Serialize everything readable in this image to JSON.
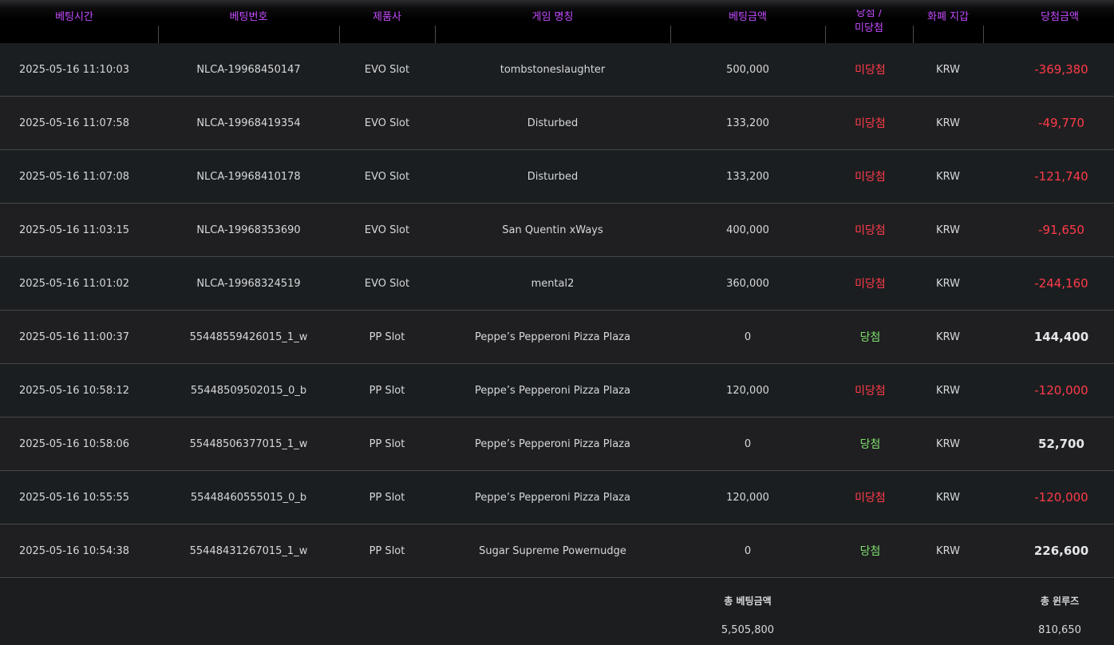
{
  "table": {
    "headers": {
      "time": "베팅시간",
      "bet_id": "베팅번호",
      "provider": "제품사",
      "game": "게임 명칭",
      "bet_amount": "베팅금액",
      "result_line1": "당첨 /",
      "result_line2": "미당첨",
      "currency": "화폐 지갑",
      "win_amount": "당첨금액"
    },
    "rows": [
      {
        "time": "2025-05-16 11:10:03",
        "bet_id": "NLCA-19968450147",
        "provider": "EVO Slot",
        "game": "tombstoneslaughter",
        "bet_amount": "500,000",
        "result": "미당첨",
        "currency": "KRW",
        "win_amount": "-369,380"
      },
      {
        "time": "2025-05-16 11:07:58",
        "bet_id": "NLCA-19968419354",
        "provider": "EVO Slot",
        "game": "Disturbed",
        "bet_amount": "133,200",
        "result": "미당첨",
        "currency": "KRW",
        "win_amount": "-49,770"
      },
      {
        "time": "2025-05-16 11:07:08",
        "bet_id": "NLCA-19968410178",
        "provider": "EVO Slot",
        "game": "Disturbed",
        "bet_amount": "133,200",
        "result": "미당첨",
        "currency": "KRW",
        "win_amount": "-121,740"
      },
      {
        "time": "2025-05-16 11:03:15",
        "bet_id": "NLCA-19968353690",
        "provider": "EVO Slot",
        "game": "San Quentin xWays",
        "bet_amount": "400,000",
        "result": "미당첨",
        "currency": "KRW",
        "win_amount": "-91,650"
      },
      {
        "time": "2025-05-16 11:01:02",
        "bet_id": "NLCA-19968324519",
        "provider": "EVO Slot",
        "game": "mental2",
        "bet_amount": "360,000",
        "result": "미당첨",
        "currency": "KRW",
        "win_amount": "-244,160"
      },
      {
        "time": "2025-05-16 11:00:37",
        "bet_id": "55448559426015_1_w",
        "provider": "PP Slot",
        "game": "Peppe’s Pepperoni Pizza Plaza",
        "bet_amount": "0",
        "result": "당첨",
        "currency": "KRW",
        "win_amount": "144,400"
      },
      {
        "time": "2025-05-16 10:58:12",
        "bet_id": "55448509502015_0_b",
        "provider": "PP Slot",
        "game": "Peppe’s Pepperoni Pizza Plaza",
        "bet_amount": "120,000",
        "result": "미당첨",
        "currency": "KRW",
        "win_amount": "-120,000"
      },
      {
        "time": "2025-05-16 10:58:06",
        "bet_id": "55448506377015_1_w",
        "provider": "PP Slot",
        "game": "Peppe’s Pepperoni Pizza Plaza",
        "bet_amount": "0",
        "result": "당첨",
        "currency": "KRW",
        "win_amount": "52,700"
      },
      {
        "time": "2025-05-16 10:55:55",
        "bet_id": "55448460555015_0_b",
        "provider": "PP Slot",
        "game": "Peppe’s Pepperoni Pizza Plaza",
        "bet_amount": "120,000",
        "result": "미당첨",
        "currency": "KRW",
        "win_amount": "-120,000"
      },
      {
        "time": "2025-05-16 10:54:38",
        "bet_id": "55448431267015_1_w",
        "provider": "PP Slot",
        "game": "Sugar Supreme Powernudge",
        "bet_amount": "0",
        "result": "당첨",
        "currency": "KRW",
        "win_amount": "226,600"
      }
    ]
  },
  "summary": {
    "total_bet_label": "총 베팅금액",
    "total_bet_value": "5,505,800",
    "total_winloss_label": "총 윈루즈",
    "total_winloss_value": "810,650"
  },
  "colors": {
    "header_text": "#c54bff",
    "lose": "#ff3b4a",
    "win": "#7ee06d"
  }
}
